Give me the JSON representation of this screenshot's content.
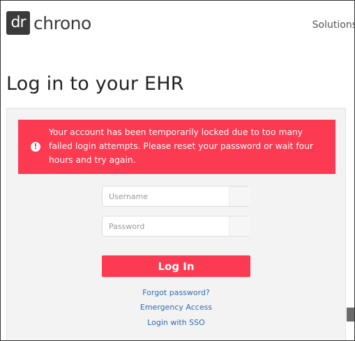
{
  "header": {
    "logo_mark": "dr",
    "logo_word": "chrono",
    "nav_solutions": "Solutions"
  },
  "page": {
    "title": "Log in to your EHR"
  },
  "alert": {
    "icon": "exclamation-circle-icon",
    "message": "Your account has been temporarily locked due to too many failed login attempts. Please reset your password or wait four hours and try again."
  },
  "form": {
    "username_placeholder": "Username",
    "username_value": "",
    "password_placeholder": "Password",
    "password_value": "",
    "login_label": "Log In"
  },
  "links": {
    "forgot": "Forgot password?",
    "emergency": "Emergency Access",
    "sso": "Login with SSO"
  },
  "colors": {
    "accent": "#fc3a51",
    "link": "#2e6db4",
    "logo_dark": "#3a3a3a",
    "panel_bg": "#f3f3f3"
  }
}
